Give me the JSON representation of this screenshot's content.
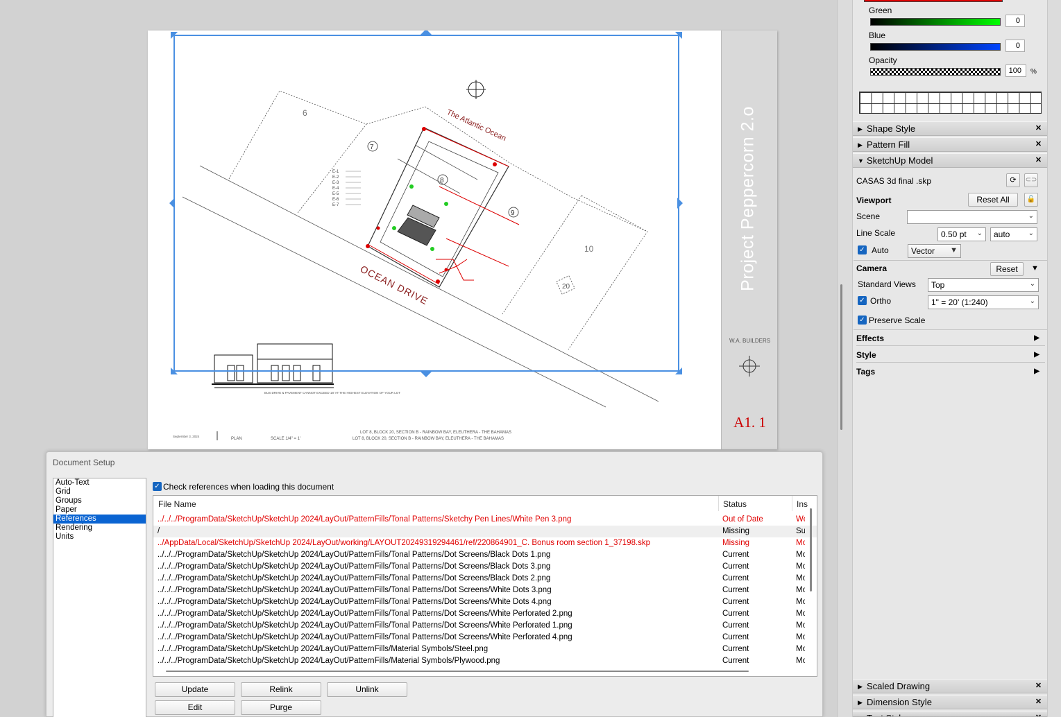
{
  "sheet": {
    "project_title": "Project Peppercorn 2.o",
    "builder": "W.A. BUILDERS",
    "sheet_number": "A1. 1",
    "date_footer": "September 3, 2024",
    "view_label": "PLAN",
    "scale_label": "SCALE 1/4\" = 1'",
    "lot_line1": "LOT 8, BLOCK 20, SECTION B - RAINBOW BAY, ELEUTHERA - THE BAHAMAS",
    "lot_line2": "LOT 8, BLOCK 20, SECTION B - RAINBOW BAY, ELEUTHERA - THE BAHAMAS",
    "ocean_label": "The Atlantic Ocean",
    "road_label": "OCEAN DRIVE",
    "lot_numbers": [
      "6",
      "7",
      "8",
      "9",
      "10",
      "20"
    ],
    "legend_items": [
      "E-1",
      "E-2",
      "E-3",
      "E-4",
      "E-5",
      "E-6",
      "E-7"
    ],
    "elevation_note": "BUS DRIVE & PAVEMENT CANNOT EXCEED 18' AT THE HIGHEST ELEVATION OF YOUR LOT"
  },
  "color_panel": {
    "green_label": "Green",
    "green_value": "0",
    "blue_label": "Blue",
    "blue_value": "0",
    "opacity_label": "Opacity",
    "opacity_value": "100",
    "opacity_unit": "%"
  },
  "tray": {
    "shape_style": "Shape Style",
    "pattern_fill": "Pattern Fill",
    "sketchup_model": "SketchUp Model",
    "model_file": "CASAS 3d final .skp",
    "viewport_label": "Viewport",
    "reset_all": "Reset All",
    "scene_label": "Scene",
    "scene_value": "",
    "line_scale_label": "Line Scale",
    "line_scale_value": "0.50 pt",
    "line_scale_mode": "auto",
    "auto_label": "Auto",
    "render_mode": "Vector",
    "camera_label": "Camera",
    "camera_reset": "Reset",
    "standard_views_label": "Standard Views",
    "standard_view_value": "Top",
    "ortho_label": "Ortho",
    "ortho_scale": "1\" = 20' (1:240)",
    "preserve_scale_label": "Preserve Scale",
    "effects": "Effects",
    "style": "Style",
    "tags": "Tags",
    "scaled_drawing": "Scaled Drawing",
    "dimension_style": "Dimension Style",
    "text_style": "Text Style"
  },
  "dialog": {
    "title": "Document Setup",
    "nav": [
      "Auto-Text",
      "Grid",
      "Groups",
      "Paper",
      "References",
      "Rendering",
      "Units"
    ],
    "nav_selected": "References",
    "check_label": "Check references when loading this document",
    "columns": [
      "File Name",
      "Status",
      "Ins"
    ],
    "rows": [
      {
        "file": "../../../ProgramData/SketchUp/SketchUp 2024/LayOut/PatternFills/Tonal Patterns/Sketchy Pen Lines/White Pen 3.png",
        "status": "Out of Date",
        "ins": "We",
        "red": true
      },
      {
        "file": "/",
        "status": "Missing",
        "ins": "Su",
        "red": false
      },
      {
        "file": "../AppData/Local/SketchUp/SketchUp 2024/LayOut/working/LAYOUT20249319294461/ref/220864901_C. Bonus room section 1_37198.skp",
        "status": "Missing",
        "ins": "Mo",
        "red": true
      },
      {
        "file": "../../../ProgramData/SketchUp/SketchUp 2024/LayOut/PatternFills/Tonal Patterns/Dot Screens/Black Dots 1.png",
        "status": "Current",
        "ins": "Mo",
        "red": false
      },
      {
        "file": "../../../ProgramData/SketchUp/SketchUp 2024/LayOut/PatternFills/Tonal Patterns/Dot Screens/Black Dots 3.png",
        "status": "Current",
        "ins": "Mo",
        "red": false
      },
      {
        "file": "../../../ProgramData/SketchUp/SketchUp 2024/LayOut/PatternFills/Tonal Patterns/Dot Screens/Black Dots 2.png",
        "status": "Current",
        "ins": "Mo",
        "red": false
      },
      {
        "file": "../../../ProgramData/SketchUp/SketchUp 2024/LayOut/PatternFills/Tonal Patterns/Dot Screens/White Dots 3.png",
        "status": "Current",
        "ins": "Mo",
        "red": false
      },
      {
        "file": "../../../ProgramData/SketchUp/SketchUp 2024/LayOut/PatternFills/Tonal Patterns/Dot Screens/White Dots 4.png",
        "status": "Current",
        "ins": "Mo",
        "red": false
      },
      {
        "file": "../../../ProgramData/SketchUp/SketchUp 2024/LayOut/PatternFills/Tonal Patterns/Dot Screens/White Perforated 2.png",
        "status": "Current",
        "ins": "Mo",
        "red": false
      },
      {
        "file": "../../../ProgramData/SketchUp/SketchUp 2024/LayOut/PatternFills/Tonal Patterns/Dot Screens/White Perforated 1.png",
        "status": "Current",
        "ins": "Mo",
        "red": false
      },
      {
        "file": "../../../ProgramData/SketchUp/SketchUp 2024/LayOut/PatternFills/Tonal Patterns/Dot Screens/White Perforated 4.png",
        "status": "Current",
        "ins": "Mo",
        "red": false
      },
      {
        "file": "../../../ProgramData/SketchUp/SketchUp 2024/LayOut/PatternFills/Material Symbols/Steel.png",
        "status": "Current",
        "ins": "Mo",
        "red": false
      },
      {
        "file": "../../../ProgramData/SketchUp/SketchUp 2024/LayOut/PatternFills/Material Symbols/Plywood.png",
        "status": "Current",
        "ins": "Mo",
        "red": false
      }
    ],
    "buttons": {
      "update": "Update",
      "relink": "Relink",
      "unlink": "Unlink",
      "edit": "Edit",
      "purge": "Purge"
    }
  },
  "colors": {
    "selection_blue": "#4a90e2",
    "missing_red": "#e00000",
    "sheet_number_red": "#cc0000",
    "accent_blue": "#0a64d2"
  }
}
